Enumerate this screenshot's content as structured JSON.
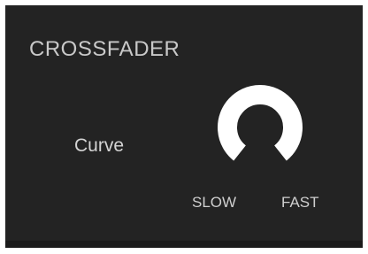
{
  "panel": {
    "title": "CROSSFADER",
    "colors": {
      "background": "#232323",
      "text": "#c9c9c9",
      "knob_arc": "#ffffff"
    }
  },
  "curve_control": {
    "label": "Curve",
    "min_label": "SLOW",
    "max_label": "FAST",
    "icon": "knob-icon",
    "value_fraction": 1.0
  }
}
